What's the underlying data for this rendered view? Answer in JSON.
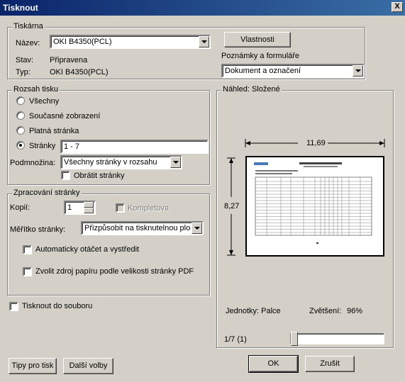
{
  "window": {
    "title": "Tisknout",
    "close_glyph": "X"
  },
  "printer": {
    "group_label": "Tiskárna",
    "name_label": "Název:",
    "name_value": "OKI B4350(PCL)",
    "status_label": "Stav:",
    "status_value": "Připravena",
    "type_label": "Typ:",
    "type_value": "OKI B4350(PCL)",
    "properties_button": "Vlastnosti",
    "comments_label": "Poznámky a formuláře",
    "comments_value": "Dokument a označení"
  },
  "range": {
    "group_label": "Rozsah tisku",
    "options": [
      {
        "label": "Všechny",
        "selected": false
      },
      {
        "label": "Současné zobrazení",
        "selected": false
      },
      {
        "label": "Platná stránka",
        "selected": false
      },
      {
        "label": "Stránky",
        "selected": true
      }
    ],
    "pages_value": "1 - 7",
    "subset_label": "Podmnožina:",
    "subset_value": "Všechny stránky v rozsahu",
    "reverse_label": "Obrátit stránky"
  },
  "handling": {
    "group_label": "Zpracování stránky",
    "copies_label": "Kopií:",
    "copies_value": "1",
    "collate_label": "Kompletova",
    "scaling_label": "Měřítko stránky:",
    "scaling_value": "Přizpůsobit na tisknutelnou ploc",
    "autorotate_label": "Automaticky otáčet a vystředit",
    "paper_source_label": "Zvolit zdroj papíru podle velikosti stránky PDF"
  },
  "print_to_file_label": "Tisknout do souboru",
  "preview": {
    "group_label": "Náhled: Složené",
    "width_value": "11,69",
    "height_value": "8,27",
    "units_label": "Jednotky: Palce",
    "zoom_label": "Zvětšení:",
    "zoom_value": "96%",
    "page_indicator": "1/7 (1)",
    "slider_fraction": 0
  },
  "buttons": {
    "tips": "Tipy pro tisk",
    "more": "Další volby",
    "ok": "OK",
    "cancel": "Zrušit"
  }
}
